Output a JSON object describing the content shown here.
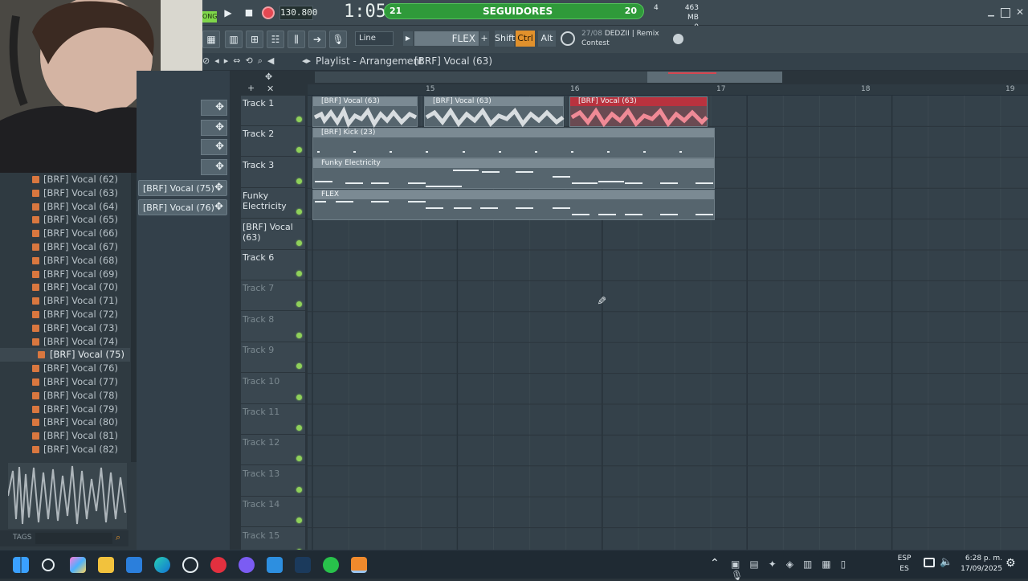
{
  "transport": {
    "song_badge": "ONG",
    "tempo": "130.800",
    "time": "1:05:",
    "memory": "463 MB",
    "cpu_top": "4",
    "cpu_bottom": "0"
  },
  "followers": {
    "label": "SEGUIDORES",
    "left": "21",
    "right": "20",
    "progress": 0.96
  },
  "toolbar": {
    "snap": "Line",
    "pattern": "FLEX",
    "shift": "Shift",
    "ctrl": "Ctrl",
    "alt": "Alt",
    "news_date": "27/08",
    "news_title": "DEDZII | Remix",
    "news_sub": "Contest"
  },
  "playlist": {
    "title": "Playlist - Arrangement",
    "breadcrumb": "[BRF] Vocal (63)"
  },
  "ruler": [
    "15",
    "16",
    "17",
    "18",
    "19"
  ],
  "channels": [
    {
      "label": "[BRF] Vocal (75)"
    },
    {
      "label": "[BRF] Vocal (76)"
    }
  ],
  "browser": {
    "items": [
      "[BRF] Vocal (62)",
      "[BRF] Vocal (63)",
      "[BRF] Vocal (64)",
      "[BRF] Vocal (65)",
      "[BRF] Vocal (66)",
      "[BRF] Vocal (67)",
      "[BRF] Vocal (68)",
      "[BRF] Vocal (69)",
      "[BRF] Vocal (70)",
      "[BRF] Vocal (71)",
      "[BRF] Vocal (72)",
      "[BRF] Vocal (73)",
      "[BRF] Vocal (74)",
      "[BRF] Vocal (75)",
      "[BRF] Vocal (76)",
      "[BRF] Vocal (77)",
      "[BRF] Vocal (78)",
      "[BRF] Vocal (79)",
      "[BRF] Vocal (80)",
      "[BRF] Vocal (81)",
      "[BRF] Vocal (82)"
    ],
    "selected": "[BRF] Vocal (75)",
    "tags_label": "TAGS"
  },
  "tracks": [
    "Track 1",
    "Track 2",
    "Track 3",
    "Funky Electricity",
    "[BRF] Vocal (63)",
    "Track 6",
    "Track 7",
    "Track 8",
    "Track 9",
    "Track 10",
    "Track 11",
    "Track 12",
    "Track 13",
    "Track 14",
    "Track 15"
  ],
  "clips": [
    {
      "label": "[BRF] Vocal (63)"
    },
    {
      "label": "[BRF] Vocal (63)"
    },
    {
      "label": "[BRF] Vocal (63)"
    },
    {
      "label": "[BRF] Kick (23)"
    },
    {
      "label": "Funky Electricity"
    },
    {
      "label": "FLEX"
    }
  ],
  "taskbar": {
    "lang_top": "ESP",
    "lang_bottom": "ES",
    "clock_time": "6:28 p. m.",
    "clock_date": "17/09/2025"
  },
  "colors": {
    "accent_green": "#2f9a3a",
    "clip_red": "#b9323e",
    "grid_bg": "#34414a",
    "led_green": "#8fd15a"
  }
}
